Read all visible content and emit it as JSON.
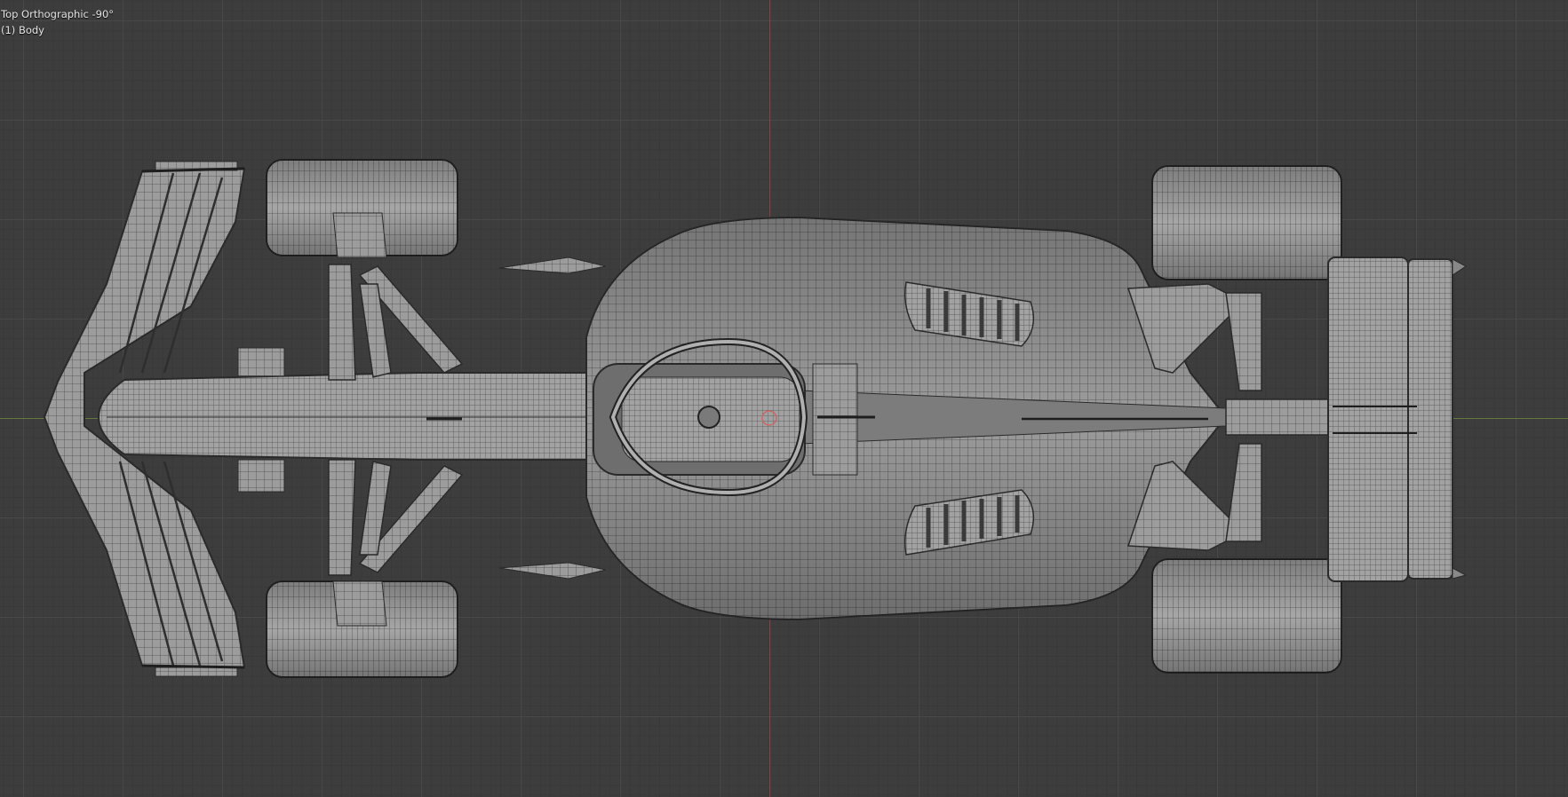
{
  "viewport": {
    "view_label": "Top Orthographic -90°",
    "active_object": "(1) Body"
  },
  "colors": {
    "background": "#3d3d3d",
    "grid_minor": "#383838",
    "grid_major": "#4a4a4a",
    "x_axis": "#6d8a3e",
    "y_axis": "#a0414b",
    "mesh_fill": "#9a9a9a",
    "wire": "#3c3c3c"
  },
  "model": {
    "description_icon": "f1-car-wireframe",
    "parts": [
      "front-wing",
      "nose",
      "front-wheel-left",
      "front-wheel-right",
      "front-suspension",
      "cockpit-halo",
      "sidepods",
      "engine-cover",
      "rear-suspension",
      "rear-wheel-left",
      "rear-wheel-right",
      "rear-wing"
    ]
  }
}
